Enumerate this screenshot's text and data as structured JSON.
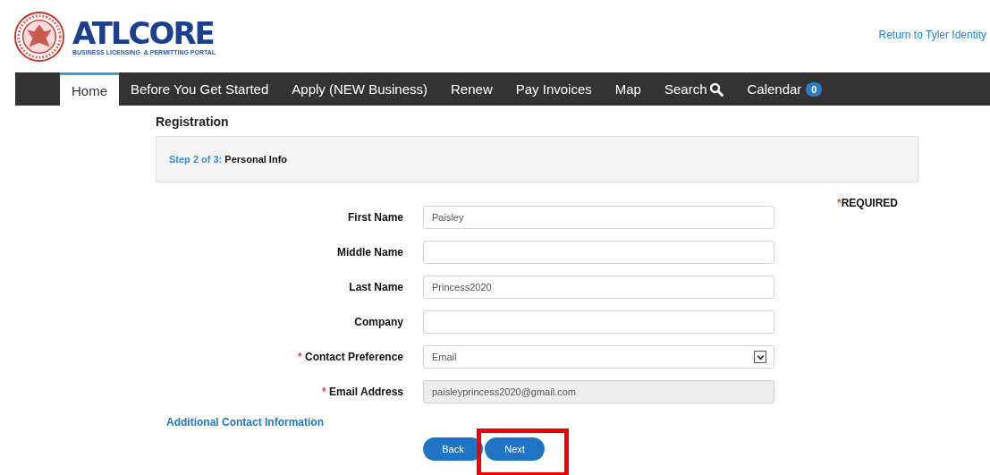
{
  "header": {
    "brand": "ATLCORE",
    "tagline": "BUSINESS LICENSING  & PERMITTING PORTAL",
    "link": "Return to Tyler Identity"
  },
  "nav": [
    {
      "label": "Home",
      "selected": true
    },
    {
      "label": "Before You Get Started",
      "selected": false
    },
    {
      "label": "Apply (NEW Business)",
      "selected": false
    },
    {
      "label": "Renew",
      "selected": false
    },
    {
      "label": "Pay Invoices",
      "selected": false
    },
    {
      "label": "Map",
      "selected": false
    },
    {
      "label": "Search",
      "selected": false,
      "kind": "search"
    },
    {
      "label": "Calendar",
      "selected": false,
      "kind": "count",
      "count": "0"
    }
  ],
  "page_title": "Registration",
  "step": {
    "progress": "Step 2 of 3:",
    "name": "Personal Info"
  },
  "required_note": {
    "mark": "*",
    "text": "REQUIRED"
  },
  "fields": [
    {
      "label": "First Name",
      "required": false,
      "kind": "text",
      "value": "Paisley",
      "disabled": false
    },
    {
      "label": "Middle Name",
      "required": false,
      "kind": "text",
      "disabled": false
    },
    {
      "label": "Last Name",
      "required": false,
      "kind": "text",
      "value": "Princess2020",
      "disabled": false
    },
    {
      "label": "Company",
      "required": false,
      "kind": "text",
      "disabled": false
    },
    {
      "label": "Contact Preference",
      "required": true,
      "kind": "select",
      "value": "Email",
      "disabled": false
    },
    {
      "label": "Email Address",
      "required": true,
      "kind": "text",
      "value": "paisleyprincess2020@gmail.com",
      "disabled": true
    }
  ],
  "required_mark": "*",
  "extra_link": "Additional Contact Information",
  "buttons": [
    {
      "label": "Back",
      "highlighted": false
    },
    {
      "label": "Next",
      "highlighted": true
    }
  ]
}
